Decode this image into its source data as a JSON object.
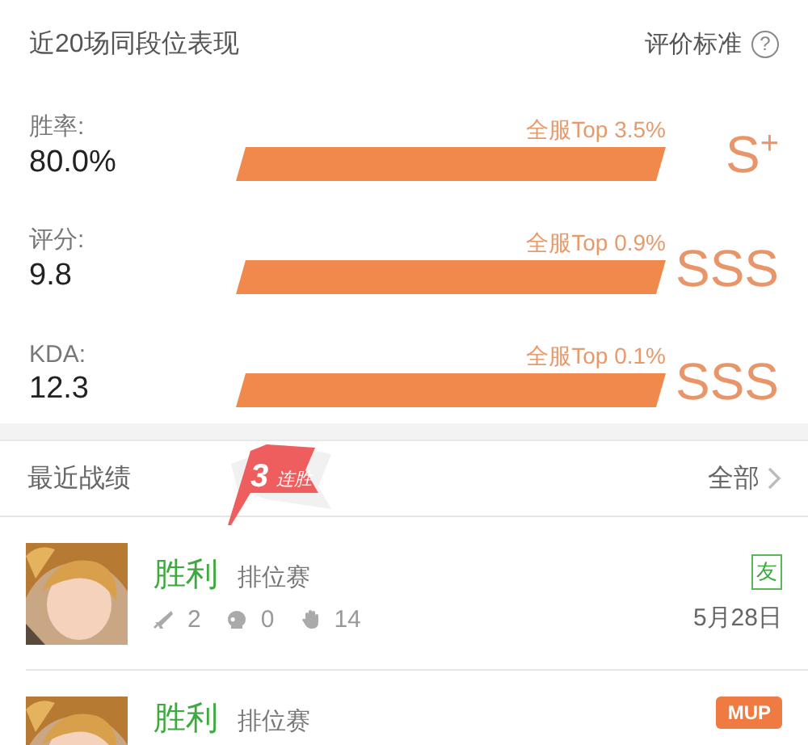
{
  "header": {
    "title": "近20场同段位表现",
    "link": "评价标准",
    "help_icon": "?"
  },
  "stats": [
    {
      "label": "胜率:",
      "value": "80.0%",
      "rank": "全服Top 3.5%",
      "grade": "S$^{+}$"
    },
    {
      "label": "评分:",
      "value": "9.8",
      "rank": "全服Top 0.9%",
      "grade": "SSS"
    },
    {
      "label": "KDA:",
      "value": "12.3",
      "rank": "全服Top 0.1%",
      "grade": "SSS"
    }
  ],
  "recent": {
    "title": "最近战绩",
    "streak_count": "3",
    "streak_label": "连胜",
    "all_link": "全部"
  },
  "matches": [
    {
      "result": "胜利",
      "mode": "排位赛",
      "kills": "2",
      "deaths": "0",
      "assists": "14",
      "date": "5月28日",
      "badge": {
        "kind": "outline",
        "text": "友"
      }
    },
    {
      "result": "胜利",
      "mode": "排位赛",
      "badge": {
        "kind": "filled",
        "text": "MUP"
      }
    }
  ]
}
